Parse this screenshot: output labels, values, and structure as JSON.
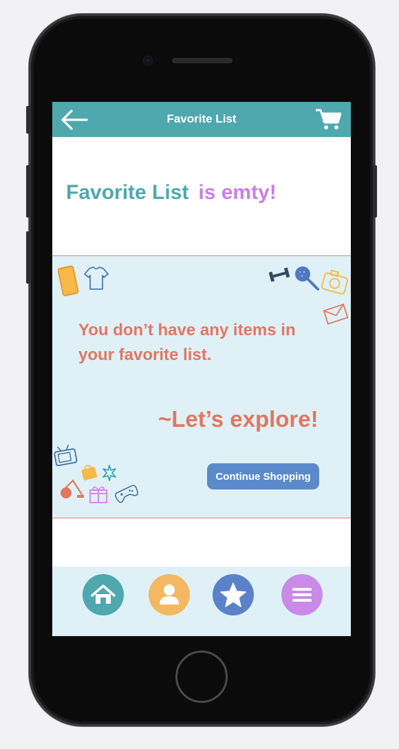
{
  "header": {
    "title": "Favorite List",
    "back_icon": "arrow-left-icon",
    "cart_icon": "cart-icon",
    "color": "#4ea8ae"
  },
  "empty_state": {
    "heading_primary": "Favorite List",
    "heading_secondary": "is emty!",
    "message": "You don’t have any items in your favorite list.",
    "explore": "~Let’s explore!",
    "cta_label": "Continue Shopping",
    "colors": {
      "primary": "#4ea8ae",
      "secondary": "#c97ee8",
      "message": "#e27662",
      "cta": "#5b8acb",
      "panel": "#dff1f6"
    },
    "decor_icons": [
      "phone-icon",
      "tshirt-icon",
      "dumbbell-icon",
      "racket-icon",
      "camera-icon",
      "mail-icon",
      "tv-icon",
      "bag-icon",
      "sparkle-icon",
      "vacuum-icon",
      "gift-icon",
      "gamepad-icon"
    ]
  },
  "bottom_nav": {
    "items": [
      {
        "name": "home",
        "icon": "home-icon",
        "color": "#4ea8ae"
      },
      {
        "name": "profile",
        "icon": "user-icon",
        "color": "#f3b861"
      },
      {
        "name": "favorites",
        "icon": "star-icon",
        "color": "#5b82c8"
      },
      {
        "name": "menu",
        "icon": "menu-icon",
        "color": "#c98ae8"
      }
    ]
  }
}
